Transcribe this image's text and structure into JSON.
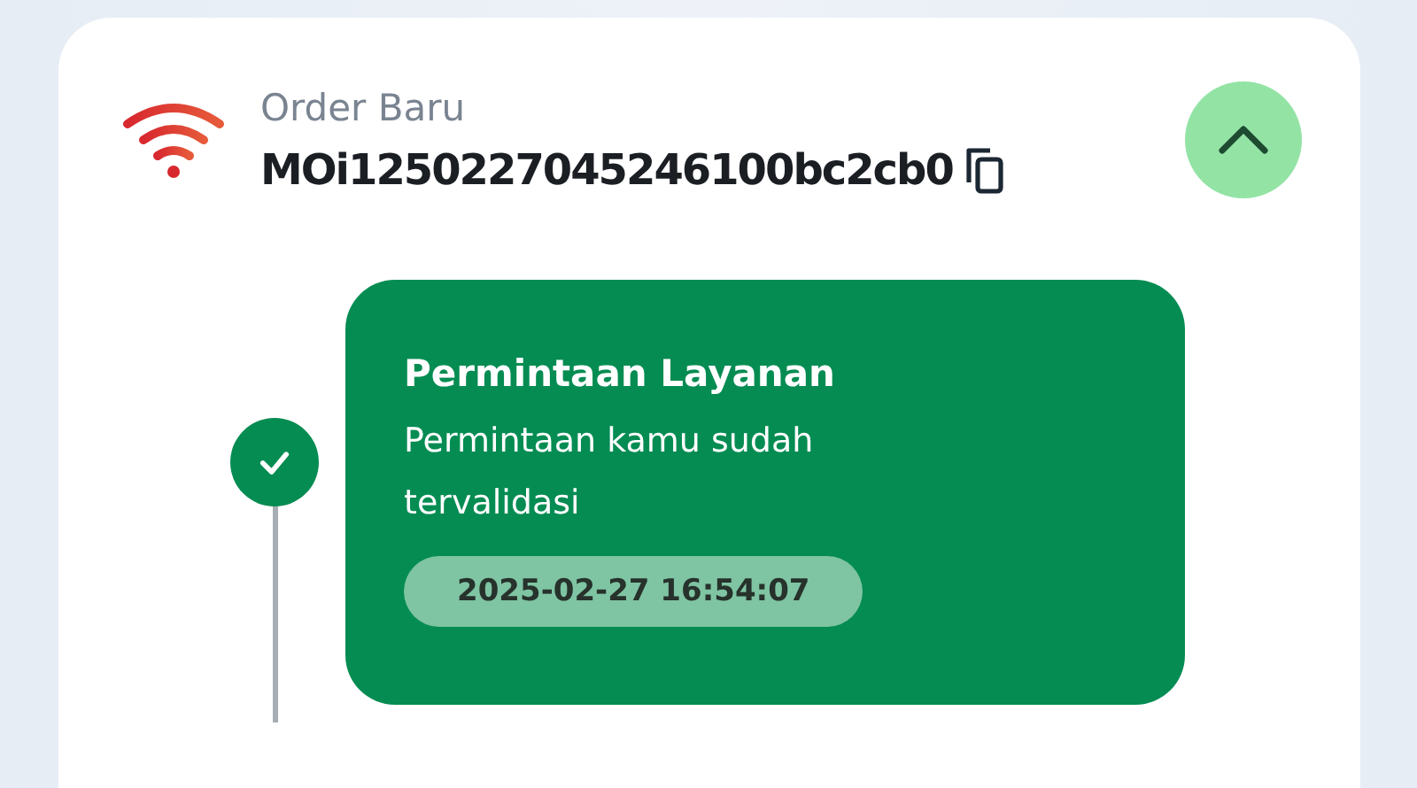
{
  "order": {
    "label": "Order Baru",
    "id": "MOi1250227045246100bc2cb0",
    "expanded": true
  },
  "timeline": [
    {
      "title": "Permintaan Layanan",
      "description": "Permintaan kamu sudah tervalidasi",
      "time": "2025-02-27 16:54:07",
      "done": true
    }
  ]
}
